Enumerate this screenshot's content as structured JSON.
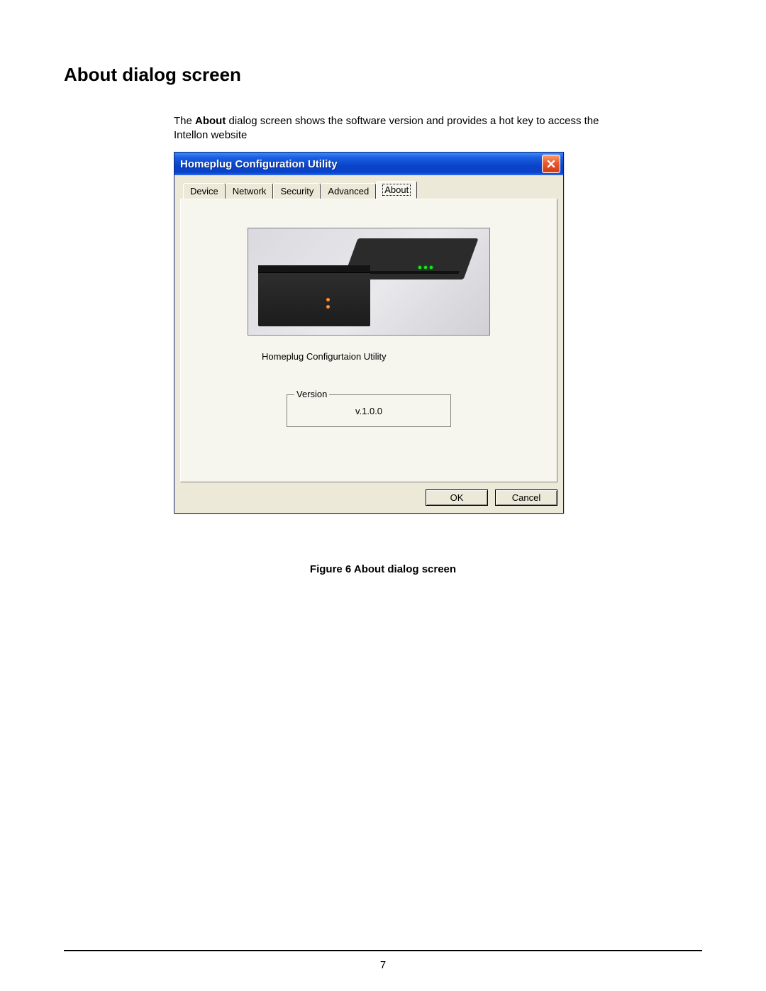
{
  "heading": "About dialog screen",
  "intro_prefix": "The ",
  "intro_bold": "About",
  "intro_rest": " dialog screen shows the software version and provides a hot key to access the Intellon website",
  "dialog": {
    "title": "Homeplug Configuration Utility",
    "tabs": {
      "device": "Device",
      "network": "Network",
      "security": "Security",
      "advanced": "Advanced",
      "about": "About"
    },
    "product_label": "Homeplug Configurtaion Utility",
    "version_legend": "Version",
    "version_value": "v.1.0.0",
    "ok_label": "OK",
    "cancel_label": "Cancel"
  },
  "caption": "Figure 6 About dialog screen",
  "page_number": "7"
}
